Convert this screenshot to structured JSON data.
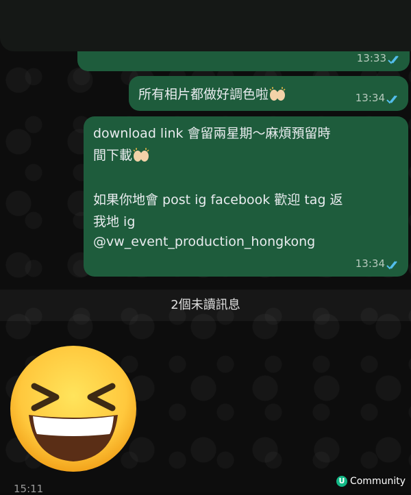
{
  "messages": {
    "m1": {
      "time": "13:33"
    },
    "m2": {
      "text": "所有相片都做好調色啦",
      "time": "13:34"
    },
    "m3": {
      "lines": [
        "download link 會留兩星期～麻煩預留時",
        "間下載",
        "如果你地會 post ig facebook 歡迎 tag 返",
        "我地 ig",
        "@vw_event_production_hongkong"
      ],
      "time": "13:34"
    }
  },
  "unread_banner": "2個未讀訊息",
  "watermark": {
    "logo": "U",
    "label": "Community"
  },
  "bottom_time": "15:11",
  "colors": {
    "bubble": "#1e5c3c",
    "tick": "#53bdeb",
    "watermark": "#12b886"
  }
}
